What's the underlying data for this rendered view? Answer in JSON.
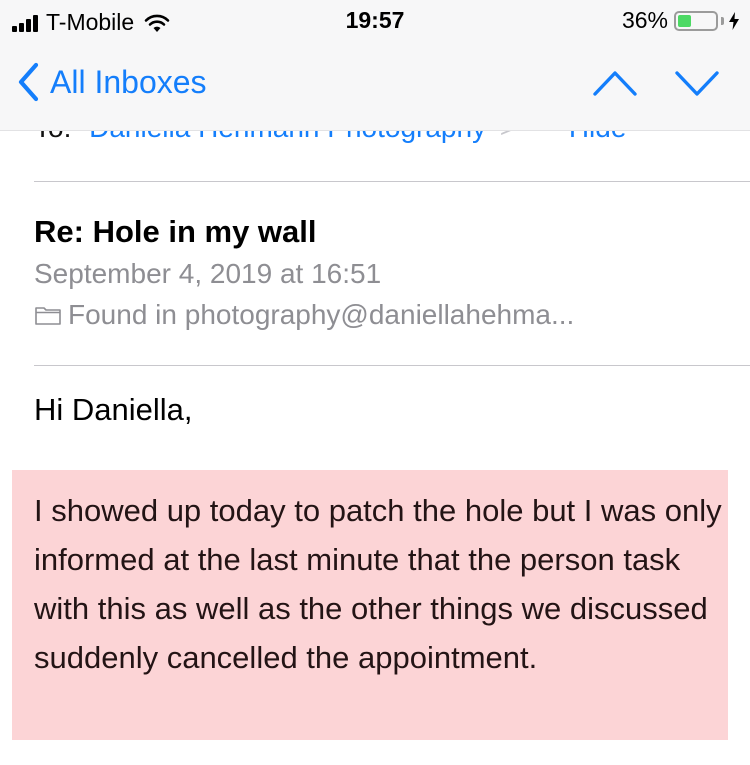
{
  "status_bar": {
    "carrier": "T-Mobile",
    "time": "19:57",
    "battery_percent": "36%",
    "battery_level": 0.36,
    "battery_color": "#4cd964"
  },
  "nav": {
    "back_label": "All Inboxes",
    "back_icon": "chevron-left-icon",
    "prev_icon": "chevron-up-icon",
    "next_icon": "chevron-down-icon",
    "accent_color": "#147efb"
  },
  "message": {
    "to_label": "To:",
    "to_name": "Daniella Hehmann Photography",
    "to_chevron": ">",
    "hide_label": "Hide",
    "subject": "Re: Hole in my wall",
    "date": "September 4, 2019 at 16:51",
    "found_in": "Found in photography@daniellahehma...",
    "greeting": "Hi Daniella,",
    "highlighted_paragraph": "I showed up today to patch the hole but I was only informed at the last minute that the person task with this as well as the other things we discussed suddenly cancelled the appointment.",
    "highlight_color": "#fcd4d6"
  }
}
